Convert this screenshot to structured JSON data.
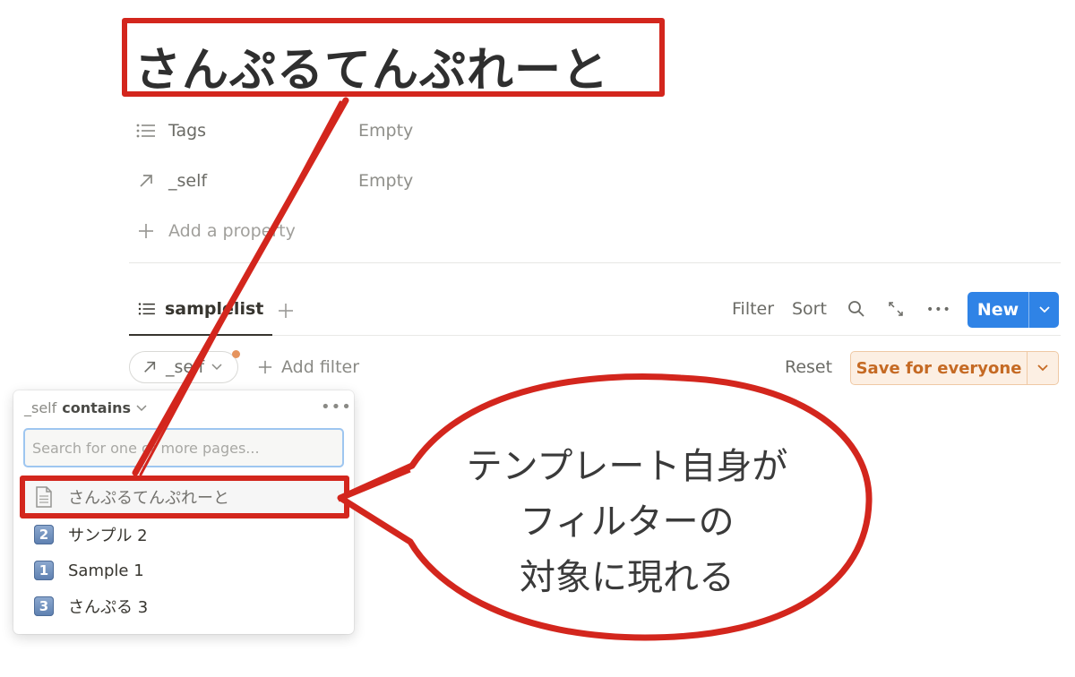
{
  "page": {
    "title": "さんぷるてんぷれーと",
    "properties": [
      {
        "icon": "list-icon",
        "label": "Tags",
        "value": "Empty"
      },
      {
        "icon": "relation-arrow-icon",
        "label": "_self",
        "value": "Empty"
      }
    ],
    "add_property": "Add a property"
  },
  "view": {
    "tab_label": "samplelist",
    "toolbar": {
      "filter": "Filter",
      "sort": "Sort",
      "more": "•••",
      "new": "New"
    },
    "filter_chip": "_self",
    "add_filter": "Add filter",
    "reset": "Reset",
    "save": "Save for everyone"
  },
  "popup": {
    "property": "_self",
    "operator": "contains",
    "more": "•••",
    "search_placeholder": "Search for one or more pages...",
    "items": [
      {
        "icon": "page-icon",
        "label": "さんぷるてんぷれーと"
      },
      {
        "icon": "keycap-2-icon",
        "badge": "2",
        "label": "サンプル 2"
      },
      {
        "icon": "keycap-1-icon",
        "badge": "1",
        "label": "Sample 1"
      },
      {
        "icon": "keycap-3-icon",
        "badge": "3",
        "label": "さんぷる 3"
      }
    ]
  },
  "annotation": {
    "lines": [
      "テンプレート自身が",
      "フィルターの",
      "対象に現れる"
    ],
    "color": "#d3261d"
  }
}
